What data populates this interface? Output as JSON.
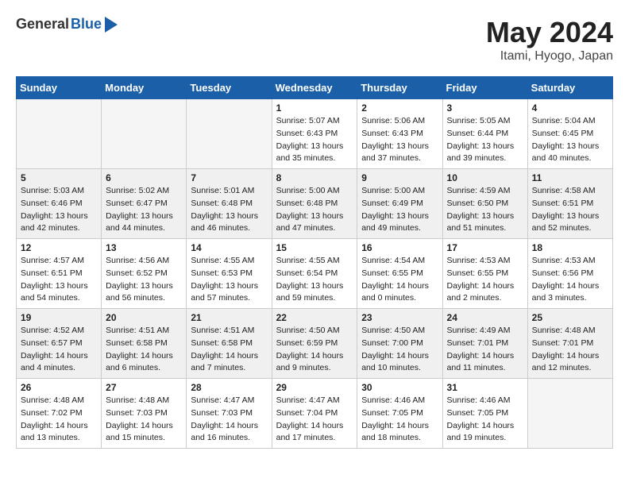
{
  "header": {
    "logo_general": "General",
    "logo_blue": "Blue",
    "month_title": "May 2024",
    "location": "Itami, Hyogo, Japan"
  },
  "days_of_week": [
    "Sunday",
    "Monday",
    "Tuesday",
    "Wednesday",
    "Thursday",
    "Friday",
    "Saturday"
  ],
  "weeks": [
    [
      {
        "num": "",
        "info": ""
      },
      {
        "num": "",
        "info": ""
      },
      {
        "num": "",
        "info": ""
      },
      {
        "num": "1",
        "info": "Sunrise: 5:07 AM\nSunset: 6:43 PM\nDaylight: 13 hours\nand 35 minutes."
      },
      {
        "num": "2",
        "info": "Sunrise: 5:06 AM\nSunset: 6:43 PM\nDaylight: 13 hours\nand 37 minutes."
      },
      {
        "num": "3",
        "info": "Sunrise: 5:05 AM\nSunset: 6:44 PM\nDaylight: 13 hours\nand 39 minutes."
      },
      {
        "num": "4",
        "info": "Sunrise: 5:04 AM\nSunset: 6:45 PM\nDaylight: 13 hours\nand 40 minutes."
      }
    ],
    [
      {
        "num": "5",
        "info": "Sunrise: 5:03 AM\nSunset: 6:46 PM\nDaylight: 13 hours\nand 42 minutes."
      },
      {
        "num": "6",
        "info": "Sunrise: 5:02 AM\nSunset: 6:47 PM\nDaylight: 13 hours\nand 44 minutes."
      },
      {
        "num": "7",
        "info": "Sunrise: 5:01 AM\nSunset: 6:48 PM\nDaylight: 13 hours\nand 46 minutes."
      },
      {
        "num": "8",
        "info": "Sunrise: 5:00 AM\nSunset: 6:48 PM\nDaylight: 13 hours\nand 47 minutes."
      },
      {
        "num": "9",
        "info": "Sunrise: 5:00 AM\nSunset: 6:49 PM\nDaylight: 13 hours\nand 49 minutes."
      },
      {
        "num": "10",
        "info": "Sunrise: 4:59 AM\nSunset: 6:50 PM\nDaylight: 13 hours\nand 51 minutes."
      },
      {
        "num": "11",
        "info": "Sunrise: 4:58 AM\nSunset: 6:51 PM\nDaylight: 13 hours\nand 52 minutes."
      }
    ],
    [
      {
        "num": "12",
        "info": "Sunrise: 4:57 AM\nSunset: 6:51 PM\nDaylight: 13 hours\nand 54 minutes."
      },
      {
        "num": "13",
        "info": "Sunrise: 4:56 AM\nSunset: 6:52 PM\nDaylight: 13 hours\nand 56 minutes."
      },
      {
        "num": "14",
        "info": "Sunrise: 4:55 AM\nSunset: 6:53 PM\nDaylight: 13 hours\nand 57 minutes."
      },
      {
        "num": "15",
        "info": "Sunrise: 4:55 AM\nSunset: 6:54 PM\nDaylight: 13 hours\nand 59 minutes."
      },
      {
        "num": "16",
        "info": "Sunrise: 4:54 AM\nSunset: 6:55 PM\nDaylight: 14 hours\nand 0 minutes."
      },
      {
        "num": "17",
        "info": "Sunrise: 4:53 AM\nSunset: 6:55 PM\nDaylight: 14 hours\nand 2 minutes."
      },
      {
        "num": "18",
        "info": "Sunrise: 4:53 AM\nSunset: 6:56 PM\nDaylight: 14 hours\nand 3 minutes."
      }
    ],
    [
      {
        "num": "19",
        "info": "Sunrise: 4:52 AM\nSunset: 6:57 PM\nDaylight: 14 hours\nand 4 minutes."
      },
      {
        "num": "20",
        "info": "Sunrise: 4:51 AM\nSunset: 6:58 PM\nDaylight: 14 hours\nand 6 minutes."
      },
      {
        "num": "21",
        "info": "Sunrise: 4:51 AM\nSunset: 6:58 PM\nDaylight: 14 hours\nand 7 minutes."
      },
      {
        "num": "22",
        "info": "Sunrise: 4:50 AM\nSunset: 6:59 PM\nDaylight: 14 hours\nand 9 minutes."
      },
      {
        "num": "23",
        "info": "Sunrise: 4:50 AM\nSunset: 7:00 PM\nDaylight: 14 hours\nand 10 minutes."
      },
      {
        "num": "24",
        "info": "Sunrise: 4:49 AM\nSunset: 7:01 PM\nDaylight: 14 hours\nand 11 minutes."
      },
      {
        "num": "25",
        "info": "Sunrise: 4:48 AM\nSunset: 7:01 PM\nDaylight: 14 hours\nand 12 minutes."
      }
    ],
    [
      {
        "num": "26",
        "info": "Sunrise: 4:48 AM\nSunset: 7:02 PM\nDaylight: 14 hours\nand 13 minutes."
      },
      {
        "num": "27",
        "info": "Sunrise: 4:48 AM\nSunset: 7:03 PM\nDaylight: 14 hours\nand 15 minutes."
      },
      {
        "num": "28",
        "info": "Sunrise: 4:47 AM\nSunset: 7:03 PM\nDaylight: 14 hours\nand 16 minutes."
      },
      {
        "num": "29",
        "info": "Sunrise: 4:47 AM\nSunset: 7:04 PM\nDaylight: 14 hours\nand 17 minutes."
      },
      {
        "num": "30",
        "info": "Sunrise: 4:46 AM\nSunset: 7:05 PM\nDaylight: 14 hours\nand 18 minutes."
      },
      {
        "num": "31",
        "info": "Sunrise: 4:46 AM\nSunset: 7:05 PM\nDaylight: 14 hours\nand 19 minutes."
      },
      {
        "num": "",
        "info": ""
      }
    ]
  ]
}
